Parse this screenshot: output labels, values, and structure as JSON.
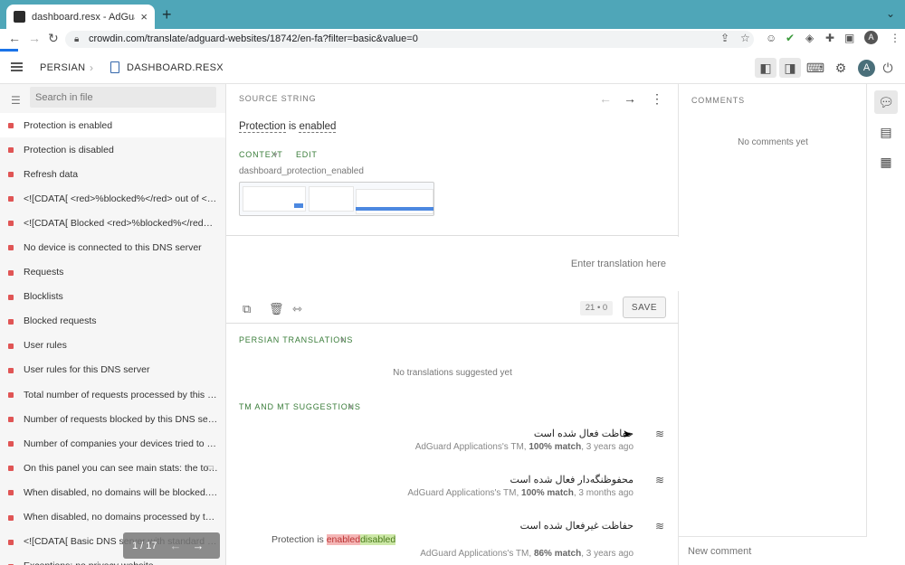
{
  "browser": {
    "tab_title": "dashboard.resx - AdGuard Web",
    "tab_close": "×",
    "new_tab": "+",
    "url": "crowdin.com/translate/adguard-websites/18742/en-fa?filter=basic&value=0",
    "profile_initial": "A"
  },
  "header": {
    "language": "PERSIAN",
    "file": "DASHBOARD.RESX",
    "profile_initial": "A"
  },
  "sidebar": {
    "search_placeholder": "Search in file",
    "items": [
      "Protection is enabled",
      "Protection is disabled",
      "Refresh data",
      "<![CDATA[ <red>%blocked%</red> out of <blue>%all%</blue> ]]>",
      "<![CDATA[ Blocked <red>%blocked%</red> out of <blue>%all%</blue> ]]>",
      "No device is connected to this DNS server",
      "Requests",
      "Blocklists",
      "Blocked requests",
      "User rules",
      "User rules for this DNS server",
      "Total number of requests processed by this DNS server",
      "Number of requests blocked by this DNS server",
      "Number of companies your devices tried to connect",
      "On this panel you can see main stats: the total",
      "When disabled, no domains will be blocked. Status",
      "When disabled, no domains processed by this server",
      "<![CDATA[ Basic DNS server with standard configuration ]]>",
      "Exceptions: no privacy website"
    ],
    "pager": "1 / 17"
  },
  "source": {
    "label": "SOURCE STRING",
    "text_part1": "Protection",
    "text_part2": " is ",
    "text_part3": "enabled",
    "context_label": "CONTEXT",
    "edit_label": "EDIT",
    "key": "dashboard_protection_enabled"
  },
  "editor": {
    "placeholder": "Enter translation here",
    "counter": "21 • 0",
    "save_label": "SAVE"
  },
  "translations": {
    "label": "PERSIAN TRANSLATIONS",
    "empty": "No translations suggested yet"
  },
  "suggestions": {
    "label": "TM AND MT SUGGESTIONS",
    "items": [
      {
        "text": "حفاظت فعال شده است",
        "source": "AdGuard Applications's TM, ",
        "match": "100% match",
        "age": ", 3 years ago"
      },
      {
        "text": "محفوظنگه‌دار فعال شده است",
        "source": "AdGuard Applications's TM, ",
        "match": "100% match",
        "age": ", 3 months ago"
      },
      {
        "text": "حفاظت غیرفعال شده است",
        "source": "AdGuard Applications's TM, ",
        "match": "86% match",
        "age": ", 3 years ago",
        "diff_prefix": "Protection is ",
        "diff_del": "enabled",
        "diff_ins": "disabled"
      }
    ]
  },
  "comments": {
    "label": "COMMENTS",
    "empty": "No comments yet",
    "new_placeholder": "New comment"
  }
}
